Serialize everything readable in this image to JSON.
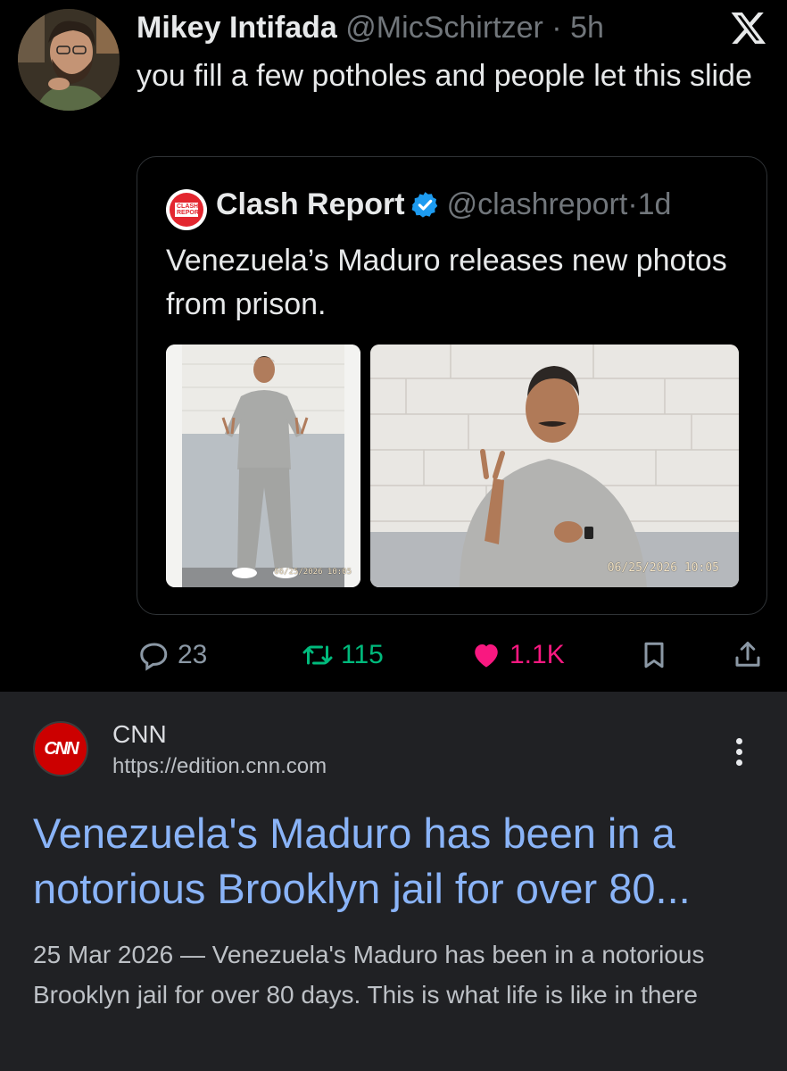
{
  "tweet": {
    "author_name": "Mikey Intifada",
    "author_handle": "@MicSchirtzer",
    "dot": "·",
    "time": "5h",
    "text": "you fill a few potholes and people let this slide",
    "logo_icon": "x-logo-icon",
    "quote": {
      "source_name": "Clash Report",
      "logo_label": "CLASH REPORT",
      "verified": true,
      "handle": "@clashreport",
      "time": "1d",
      "text": "Venezuela’s Maduro releases new photos from prison.",
      "photos": [
        {
          "timestamp": "06/25/2026 10:05"
        },
        {
          "timestamp": "06/25/2026 10:05"
        }
      ]
    },
    "actions": {
      "replies": "23",
      "retweets": "115",
      "likes": "1.1K"
    },
    "colors": {
      "retweet": "#00ba7c",
      "like": "#f91880",
      "verified": "#1d9bf0"
    }
  },
  "search_result": {
    "site_name": "CNN",
    "logo_text": "CNN",
    "url": "https://edition.cnn.com",
    "title": "Venezuela's Maduro has been in a notorious Brooklyn jail for over 80...",
    "snippet": "25 Mar 2026 — Venezuela's Maduro has been in a notorious Brooklyn jail for over 80 days. This is what life is like in there",
    "colors": {
      "title": "#8ab4f8",
      "background": "#202124"
    }
  }
}
